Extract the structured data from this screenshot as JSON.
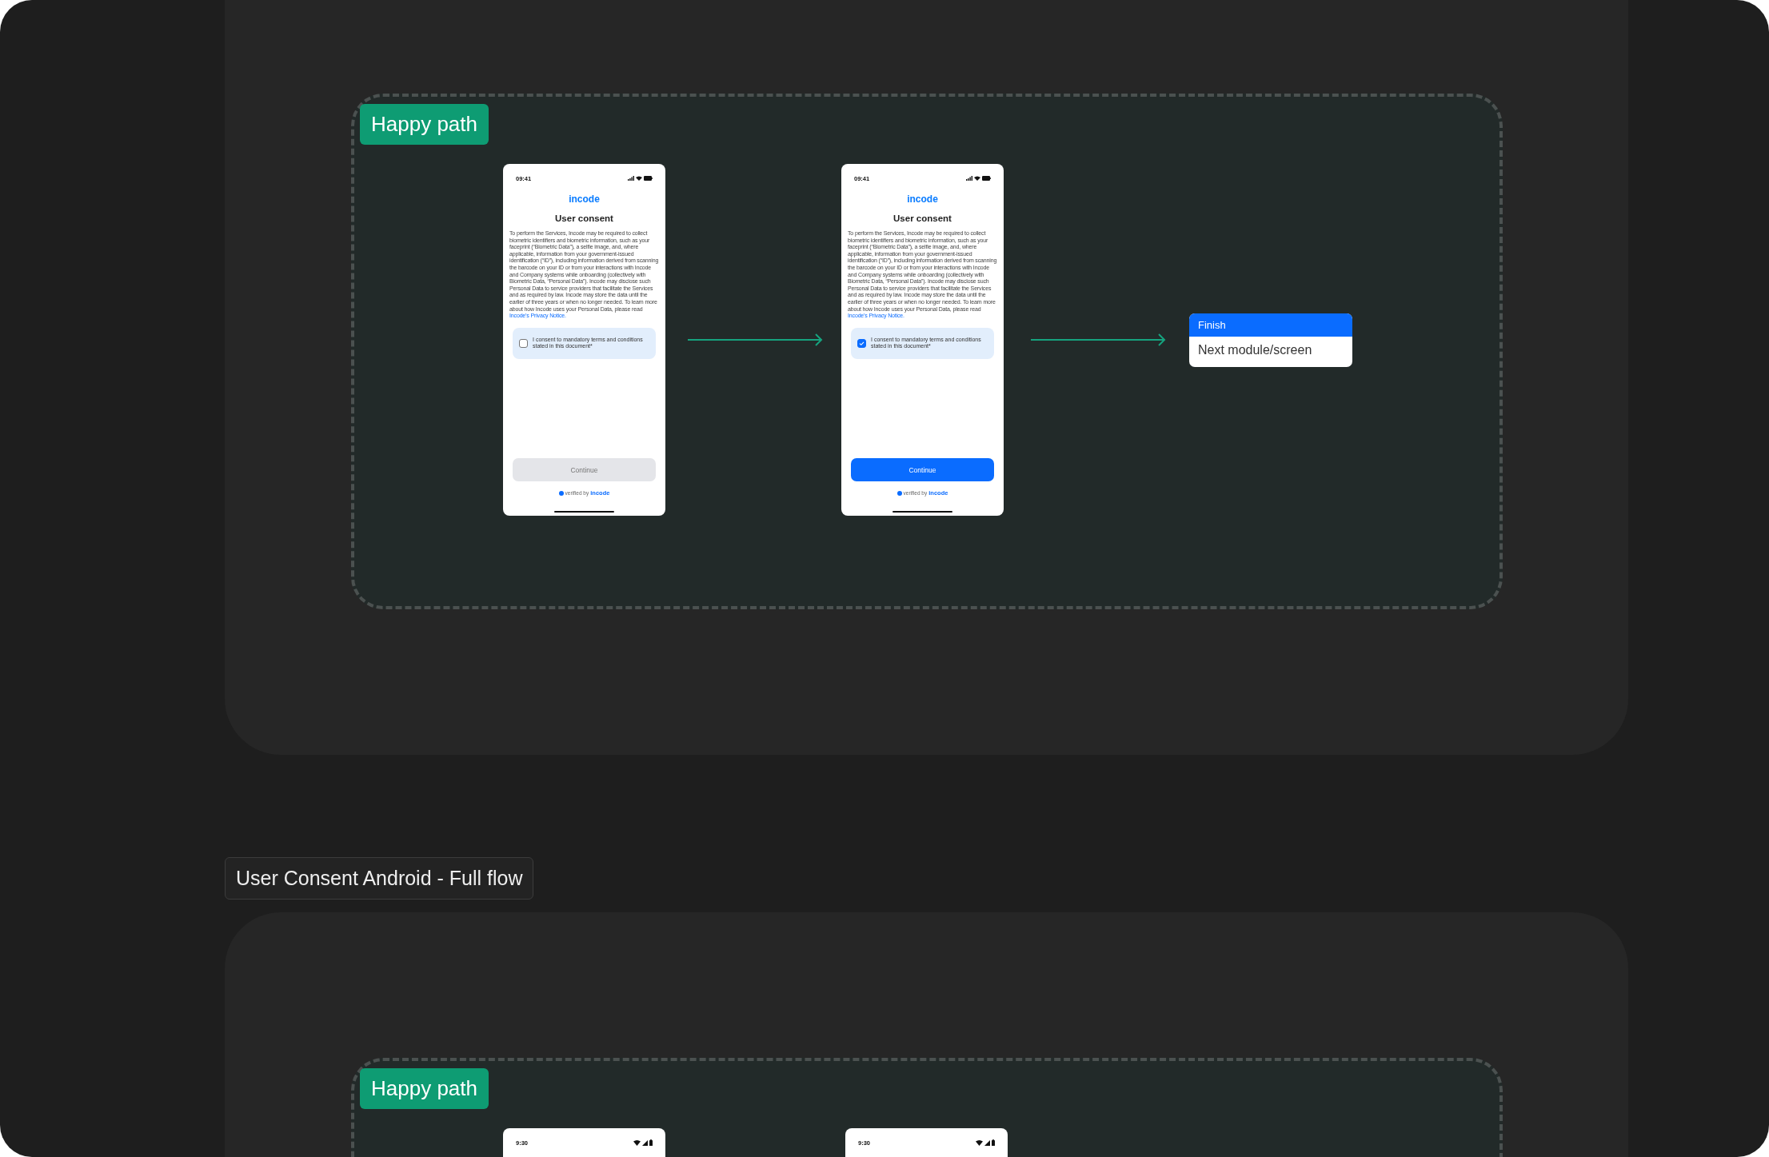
{
  "flows": [
    {
      "frames": [
        {
          "tag": "Happy path",
          "steps": [
            {
              "kind": "ios_phone",
              "time": "09:41",
              "logo": "incode",
              "title": "User consent",
              "body": "To perform the Services, Incode may be required to collect biometric identifiers and biometric information, such as your faceprint (“Biometric Data”), a selfie image, and, where applicable, information from your government-issued identification (“ID”), including information derived from scanning the barcode on your ID or from your interactions with Incode and Company systems while onboarding (collectively with Biometric Data, “Personal Data”). Incode may disclose such Personal Data to service providers that facilitate the Services and as required by law. Incode may store the data until the earlier of three years or when no longer needed. To learn more about how Incode uses your Personal Data, please read",
              "link": "Incode's Privacy Notice.",
              "consent": {
                "label": "I consent to mandatory terms and conditions stated in this document*",
                "checked": false
              },
              "button": {
                "label": "Continue",
                "disabled": true
              },
              "footer": {
                "text": "verified by",
                "brand": "incode"
              }
            },
            {
              "kind": "arrow"
            },
            {
              "kind": "ios_phone",
              "time": "09:41",
              "logo": "incode",
              "title": "User consent",
              "body": "To perform the Services, Incode may be required to collect biometric identifiers and biometric information, such as your faceprint (“Biometric Data”), a selfie image, and, where applicable, information from your government-issued identification (“ID”), including information derived from scanning the barcode on your ID or from your interactions with Incode and Company systems while onboarding (collectively with Biometric Data, “Personal Data”). Incode may disclose such Personal Data to service providers that facilitate the Services and as required by law. Incode may store the data until the earlier of three years or when no longer needed. To learn more about how Incode uses your Personal Data, please read",
              "link": "Incode's Privacy Notice.",
              "consent": {
                "label": "I consent to mandatory terms and conditions stated in this document*",
                "checked": true
              },
              "button": {
                "label": "Continue",
                "disabled": false
              },
              "footer": {
                "text": "verified by",
                "brand": "incode"
              }
            },
            {
              "kind": "arrow"
            },
            {
              "kind": "finish",
              "header": "Finish",
              "body": "Next module/screen"
            }
          ]
        }
      ]
    },
    {
      "label": "User Consent  Android - Full flow",
      "frames": [
        {
          "tag": "Happy path",
          "steps": [
            {
              "kind": "android_phone",
              "time": "9:30"
            },
            {
              "kind": "android_phone",
              "time": "9:30"
            }
          ]
        }
      ]
    }
  ]
}
